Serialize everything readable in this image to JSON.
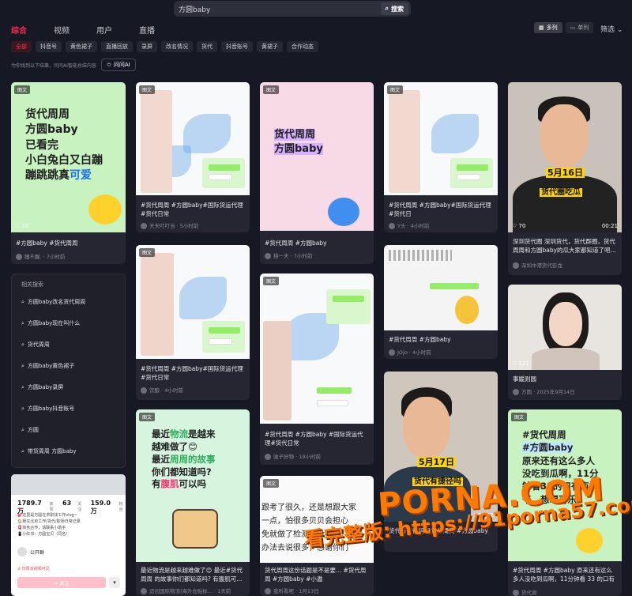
{
  "search": {
    "value": "方圆baby",
    "button": "搜索"
  },
  "tabs": [
    {
      "label": "综合",
      "active": true
    },
    {
      "label": "视频",
      "active": false
    },
    {
      "label": "用户",
      "active": false
    },
    {
      "label": "直播",
      "active": false
    }
  ],
  "view": {
    "multi": "多列",
    "single": "单列",
    "filter": "筛选"
  },
  "chips": [
    "全部",
    "抖音号",
    "黄色裙子",
    "直播回放",
    "录屏",
    "改名情况",
    "货代",
    "抖音账号",
    "黄裙子",
    "合作动态"
  ],
  "notice": "为你找到以下结果，问问AI智能总结内容",
  "ask_ai": "问问AI",
  "badge": "图文",
  "cards": [
    {
      "title": "#方圆baby #货代周周",
      "author": "睡不醒.",
      "time": "7小时前",
      "likes": "10",
      "text": [
        "货代周周",
        "方圆baby",
        "已看完",
        "小白兔白又白蹦",
        "蹦跳跳真",
        "可爱"
      ]
    },
    {
      "title": "#货代周周 #方圆baby#国际货运代理#货代日常",
      "author": "天天叮叮当",
      "time": "5小时前"
    },
    {
      "title": "#货代周周 #方圆baby",
      "author": "猫一天",
      "time": "7小时前",
      "text": [
        "货代周周",
        "方圆baby"
      ]
    },
    {
      "title": "#货代周周 #方圆baby#国际货运代理#货代日",
      "author": "Y头",
      "time": "4小时前"
    },
    {
      "title": "深圳货代圈 深圳货代，货代群圈，货代周周和方圆baby的瓜大家都知道了吧...",
      "author": "深圳中港货代彭龙",
      "likes": "70",
      "duration": "00:21",
      "overlay": [
        "5月16日",
        "货代圈吃瓜"
      ]
    },
    {
      "title": "#货代周周 #方圆baby#国际货运代理#货代日常",
      "author": "饮酿",
      "time": "4小时前"
    },
    {
      "title": "#货代周周 #方圆baby",
      "author": "JOjo",
      "time": "4小时前"
    },
    {
      "title": "事媛则圆",
      "author": "方圆",
      "time": "2025年9月14日",
      "likes": "121"
    },
    {
      "title": "#货代周周 #方圆baby #国际货运代理#货代日常",
      "author": "驰子好物",
      "time": "19小时前"
    },
    {
      "title": "最近物流是越来越难做了😊 最近#货代周周 的故事你们都知道吗? 有腹肌可...",
      "author": "迈创国际物流|海外仓贴标...",
      "time": "1天前",
      "text": [
        "最近物流是越来",
        "越难做了😊",
        "最近周周的故事",
        "你们都知道吗?",
        "有腹肌可以吗"
      ]
    },
    {
      "title": "货代有捷径吗 #货代周周 #方圆baby",
      "author": "",
      "time": "",
      "duration": "00:12",
      "overlay": [
        "5月17日",
        "货代有捷径吗"
      ]
    },
    {
      "title": "#货代周周 #方圆baby 原来还有这么多人没吃到瓜啊，11分钟看 33 的口有点...",
      "author": "货代周",
      "time": "",
      "text": [
        "#货代周周",
        "#方圆baby",
        "原来还有这么多人",
        "没吃到瓜啊，11分",
        "钟看33的口有点",
        "干，想喝可乐"
      ]
    },
    {
      "title": "货代周周这份话题是不是要... #货代周周 #方圆baby #小遨",
      "author": "我听看呢",
      "time": "1月13日",
      "text": [
        "跟考了很久，还是想跟大家",
        "一点，怕很多贝贝会担心",
        "免就做了检测，没事的，我",
        "办法去说很多，感谢你们"
      ]
    }
  ],
  "related": {
    "title": "相关搜索",
    "items": [
      "方圆baby改名货代周周",
      "方圆baby现在叫什么",
      "货代周周",
      "方圆baby黄色裙子",
      "方圆baby录屏",
      "方圆baby抖音账号",
      "方圆",
      "带货周周 方圆baby"
    ]
  },
  "profile": {
    "following": "1789.7万",
    "following_label": "获赞",
    "fans": "63",
    "fans_label": "关注",
    "likes": "159.0万",
    "likes_label": "粉丝",
    "bio": [
      "💕这里是方圆在求职找工作vlog~",
      "🏠我在北京工作/货代/职场日常记录",
      "📮商务合作，请联系小助手",
      "📱小红书：方圆宝贝（同名）"
    ],
    "extra": "公开群",
    "follow": "+ 关注",
    "report": "仅限本视频可见"
  },
  "watermark": {
    "site": "PORNA.COM",
    "url": "看完整版: https://91porna57.com"
  }
}
